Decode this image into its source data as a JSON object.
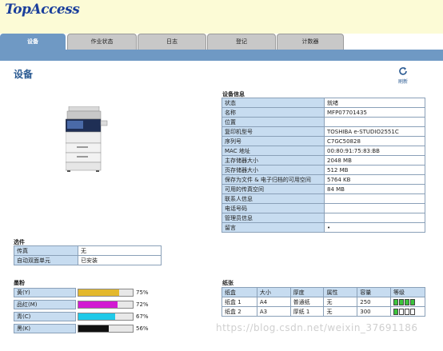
{
  "app": {
    "logo": "TopAccess"
  },
  "tabs": [
    {
      "label": "设备",
      "active": true
    },
    {
      "label": "作业状态",
      "active": false
    },
    {
      "label": "日志",
      "active": false
    },
    {
      "label": "登记",
      "active": false
    },
    {
      "label": "计数器",
      "active": false
    }
  ],
  "page": {
    "title": "设备",
    "refresh_label": "刷新"
  },
  "options": {
    "title": "选件",
    "rows": [
      {
        "k": "传真",
        "v": "无"
      },
      {
        "k": "自动双面单元",
        "v": "已安装"
      }
    ]
  },
  "toner": {
    "title": "墨粉",
    "rows": [
      {
        "name": "黄(Y)",
        "percent": 75,
        "color": "#e3b82d"
      },
      {
        "name": "品红(M)",
        "percent": 72,
        "color": "#d21bd2"
      },
      {
        "name": "青(C)",
        "percent": 67,
        "color": "#1fc9e8"
      },
      {
        "name": "黑(K)",
        "percent": 56,
        "color": "#111111"
      }
    ],
    "pct_texts": [
      "75%",
      "72%",
      "67%",
      "56%"
    ]
  },
  "device_info": {
    "title": "设备信息",
    "rows": [
      {
        "k": "状态",
        "v": "就绪"
      },
      {
        "k": "名称",
        "v": "MFP07701435"
      },
      {
        "k": "位置",
        "v": ""
      },
      {
        "k": "复印机型号",
        "v": "TOSHIBA e-STUDIO2551C"
      },
      {
        "k": "序列号",
        "v": "C7GC50828"
      },
      {
        "k": "MAC 地址",
        "v": "00:80:91:75:83:BB"
      },
      {
        "k": "主存储器大小",
        "v": "2048 MB"
      },
      {
        "k": "页存储器大小",
        "v": "512 MB"
      },
      {
        "k": "保存为文件 & 电子归档的可用空间",
        "v": "5764 KB"
      },
      {
        "k": "可用的传真空间",
        "v": "84 MB"
      },
      {
        "k": "联系人信息",
        "v": ""
      },
      {
        "k": "电话号码",
        "v": ""
      },
      {
        "k": "管理员信息",
        "v": ""
      },
      {
        "k": "留言",
        "v": "•"
      }
    ]
  },
  "paper": {
    "title": "纸张",
    "headers": [
      "纸盒",
      "大小",
      "厚度",
      "属性",
      "容量",
      "等级"
    ],
    "rows": [
      {
        "tray": "纸盒 1",
        "size": "A4",
        "thickness": "普通纸",
        "attr": "无",
        "capacity": "250",
        "level": 4
      },
      {
        "tray": "纸盒 2",
        "size": "A3",
        "thickness": "厚纸 1",
        "attr": "无",
        "capacity": "300",
        "level": 1
      }
    ],
    "level_max": 4,
    "colors": {
      "full": "#3cc43c",
      "empty": "#ffffff"
    }
  },
  "watermark": "https://blog.csdn.net/weixin_37691186"
}
